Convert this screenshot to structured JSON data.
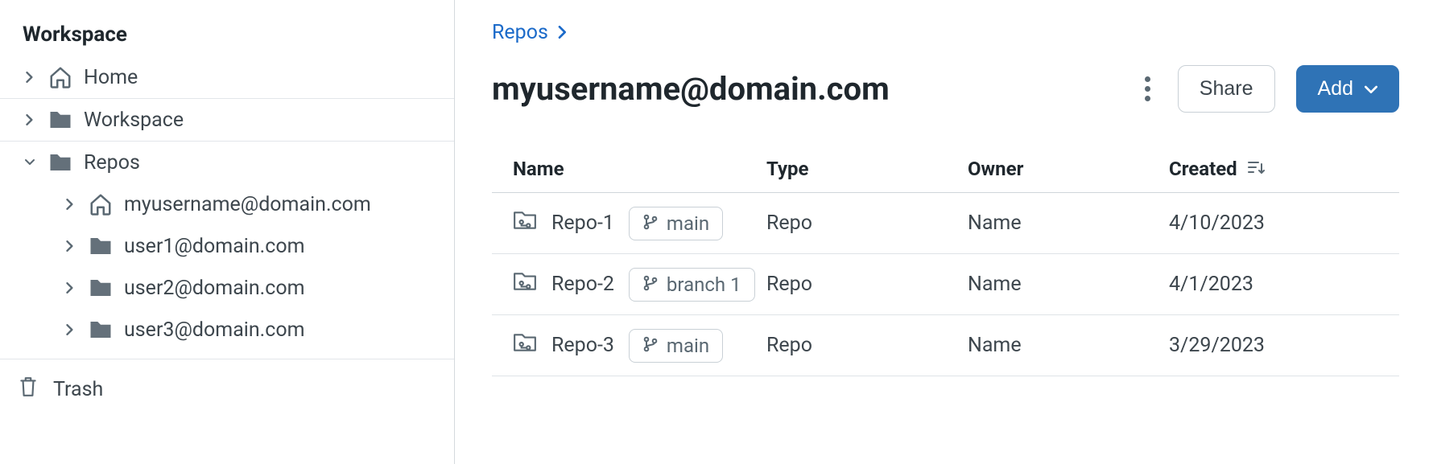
{
  "sidebar": {
    "header": "Workspace",
    "home_label": "Home",
    "workspace_label": "Workspace",
    "repos_label": "Repos",
    "repo_users": [
      {
        "label": "myusername@domain.com",
        "icon": "home"
      },
      {
        "label": "user1@domain.com",
        "icon": "folder"
      },
      {
        "label": "user2@domain.com",
        "icon": "folder"
      },
      {
        "label": "user3@domain.com",
        "icon": "folder"
      }
    ],
    "trash_label": "Trash"
  },
  "breadcrumb": {
    "root": "Repos"
  },
  "page_title": "myusername@domain.com",
  "actions": {
    "share": "Share",
    "add": "Add"
  },
  "table": {
    "headers": {
      "name": "Name",
      "type": "Type",
      "owner": "Owner",
      "created": "Created"
    },
    "rows": [
      {
        "name": "Repo-1",
        "branch": "main",
        "type": "Repo",
        "owner": "Name",
        "created": "4/10/2023"
      },
      {
        "name": "Repo-2",
        "branch": "branch 1",
        "type": "Repo",
        "owner": "Name",
        "created": "4/1/2023"
      },
      {
        "name": "Repo-3",
        "branch": "main",
        "type": "Repo",
        "owner": "Name",
        "created": "3/29/2023"
      }
    ]
  }
}
